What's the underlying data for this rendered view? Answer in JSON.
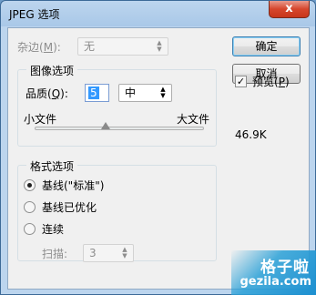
{
  "window": {
    "title": "JPEG 选项",
    "close_glyph": "x"
  },
  "matte": {
    "label": "杂边",
    "mnemonic": "M",
    "value": "无"
  },
  "image_options": {
    "group_title": "图像选项",
    "quality_label": "品质",
    "quality_mnemonic": "Q",
    "quality_value": "5",
    "quality_preset": "中",
    "quality_level": 5,
    "quality_max": 12,
    "small_file_label": "小文件",
    "large_file_label": "大文件"
  },
  "format_options": {
    "group_title": "格式选项",
    "options": [
      "基线(\"标准\")",
      "基线已优化",
      "连续"
    ],
    "selected_index": 0,
    "scans_label": "扫描",
    "scans_value": "3"
  },
  "buttons": {
    "ok": "确定",
    "cancel": "取消"
  },
  "preview": {
    "label": "预览",
    "mnemonic": "P",
    "checked": true,
    "check_glyph": "✓"
  },
  "file_size": "46.9K",
  "watermark": {
    "brand": "格子啦",
    "domain": "gezila.com"
  },
  "colors": {
    "title_bar": "#a9c8e8",
    "client_bg": "#f0f0f0",
    "selection": "#3399ff",
    "watermark": "#1c8fd0"
  }
}
